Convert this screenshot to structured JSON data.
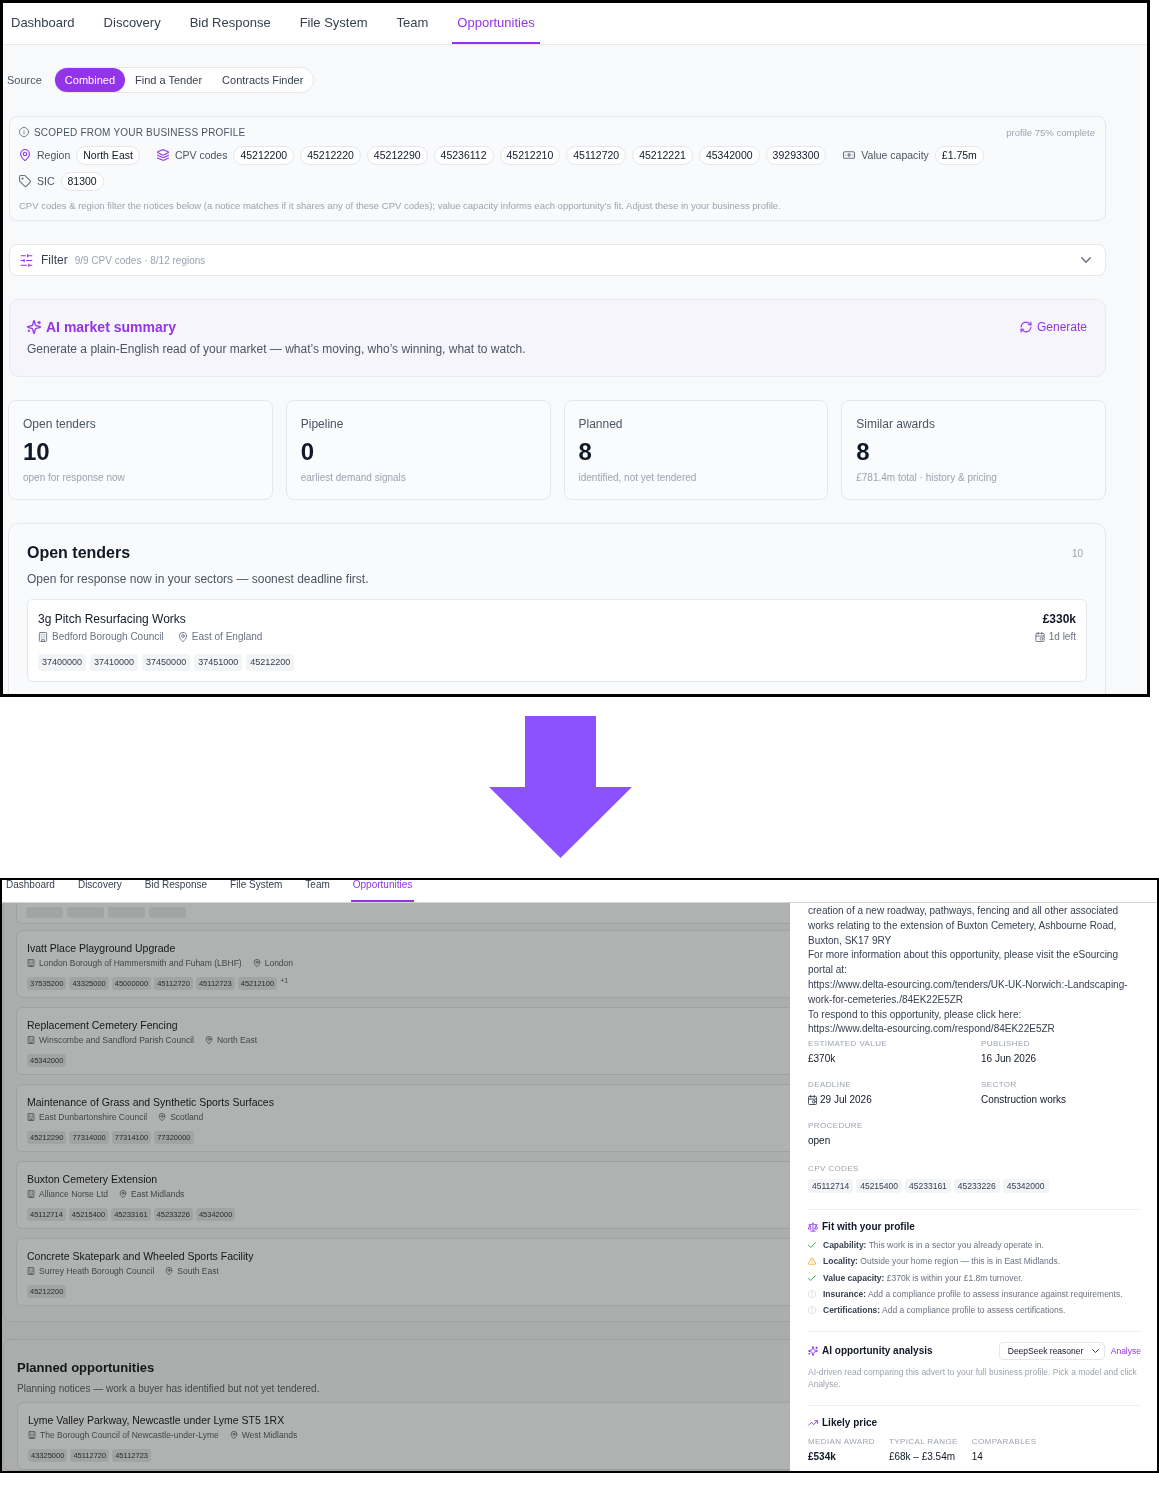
{
  "top_screen": {
    "nav": [
      {
        "label": "Dashboard",
        "selected": false
      },
      {
        "label": "Discovery",
        "selected": false
      },
      {
        "label": "Bid Response",
        "selected": false
      },
      {
        "label": "File System",
        "selected": false
      },
      {
        "label": "Team",
        "selected": false
      },
      {
        "label": "Opportunities",
        "selected": true
      }
    ],
    "source": {
      "label": "Source",
      "options": [
        {
          "label": "Combined",
          "selected": true
        },
        {
          "label": "Find a Tender",
          "selected": false
        },
        {
          "label": "Contracts Finder",
          "selected": false
        }
      ]
    },
    "profile": {
      "heading": "SCOPED FROM YOUR BUSINESS PROFILE",
      "completion": "profile 75% complete",
      "groups": [
        {
          "kind": "region",
          "label": "Region",
          "chips": [
            "North East"
          ]
        },
        {
          "kind": "cpv",
          "label": "CPV codes",
          "chips": [
            "45212200",
            "45212220",
            "45212290",
            "45236112",
            "45212210",
            "45112720",
            "45212221",
            "45342000",
            "39293300"
          ]
        },
        {
          "kind": "value",
          "label": "Value capacity",
          "chips": [
            "£1.75m"
          ]
        },
        {
          "kind": "sic",
          "label": "SIC",
          "chips": [
            "81300"
          ]
        }
      ],
      "note": "CPV codes & region filter the notices below (a notice matches if it shares any of these CPV codes); value capacity informs each opportunity’s fit. Adjust these in your business profile."
    },
    "filter": {
      "label": "Filter",
      "summary": "9/9 CPV codes · 8/12 regions",
      "expanded": false
    },
    "ai_summary": {
      "title": "AI market summary",
      "text": "Generate a plain-English read of your market — what’s moving, who’s winning, what to watch.",
      "action": "Generate"
    },
    "stats": [
      {
        "label": "Open tenders",
        "value": "10",
        "caption": "open for response now"
      },
      {
        "label": "Pipeline",
        "value": "0",
        "caption": "earliest demand signals"
      },
      {
        "label": "Planned",
        "value": "8",
        "caption": "identified, not yet tendered"
      },
      {
        "label": "Similar awards",
        "value": "8",
        "caption": "£781.4m total · history & pricing"
      }
    ],
    "open_tenders": {
      "title": "Open tenders",
      "count": "10",
      "subtitle": "Open for response now in your sectors — soonest deadline first.",
      "items": [
        {
          "title": "3g Pitch Resurfacing Works",
          "buyer": "Bedford Borough Council",
          "region": "East of England",
          "codes": [
            "37400000",
            "37410000",
            "37450000",
            "37451000",
            "45212200"
          ],
          "value": "£330k",
          "deadline": "1d left"
        }
      ]
    }
  },
  "bottom_screen": {
    "nav": [
      {
        "label": "Dashboard",
        "selected": false
      },
      {
        "label": "Discovery",
        "selected": false
      },
      {
        "label": "Bid Response",
        "selected": false
      },
      {
        "label": "File System",
        "selected": false
      },
      {
        "label": "Team",
        "selected": false
      },
      {
        "label": "Opportunities",
        "selected": true
      }
    ],
    "backdrop": true,
    "open_tenders": {
      "items": [
        {
          "title": "Ivatt Place Playground Upgrade",
          "buyer": "London Borough of Hammersmith and Fuham (LBHF)",
          "region": "London",
          "codes": [
            "37535200",
            "43325000",
            "45000000",
            "45112720",
            "45112723",
            "45212100"
          ],
          "more": "+1"
        },
        {
          "title": "Replacement Cemetery Fencing",
          "buyer": "Winscombe and Sandford Parish Council",
          "region": "North East",
          "codes": [
            "45342000"
          ]
        },
        {
          "title": "Maintenance of Grass and Synthetic Sports Surfaces",
          "buyer": "East Dunbartonshire Council",
          "region": "Scotland",
          "codes": [
            "45212290",
            "77314000",
            "77314100",
            "77320000"
          ]
        },
        {
          "title": "Buxton Cemetery Extension",
          "buyer": "Alliance Norse Ltd",
          "region": "East Midlands",
          "codes": [
            "45112714",
            "45215400",
            "45233161",
            "45233226",
            "45342000"
          ]
        },
        {
          "title": "Concrete Skatepark and Wheeled Sports Facility",
          "buyer": "Surrey Heath Borough Council",
          "region": "South East",
          "codes": [
            "45212200"
          ]
        }
      ]
    },
    "planned": {
      "title": "Planned opportunities",
      "subtitle": "Planning notices — work a buyer has identified but not yet tendered.",
      "items": [
        {
          "title": "Lyme Valley Parkway, Newcastle under Lyme ST5 1RX",
          "buyer": "The Borough Council of Newcastle-under-Lyme",
          "region": "West Midlands",
          "codes": [
            "43325000",
            "45112720",
            "45112723"
          ]
        }
      ]
    },
    "detail": {
      "description": [
        "creation of a new roadway, pathways, fencing and all other associated works relating to the extension of Buxton Cemetery, Ashbourne Road, Buxton, SK17 9RY",
        "For more information about this opportunity, please visit the eSourcing portal at:",
        "https://www.delta-esourcing.com/tenders/UK-UK-Norwich:-Landscaping-work-for-cemeteries./84EK22E5ZR",
        "To respond to this opportunity, please click here:",
        "https://www.delta-esourcing.com/respond/84EK22E5ZR"
      ],
      "fields": [
        {
          "kind": "text",
          "label": "ESTIMATED VALUE",
          "value": "£370k"
        },
        {
          "kind": "text",
          "label": "PUBLISHED",
          "value": "16 Jun 2026"
        },
        {
          "kind": "date",
          "label": "DEADLINE",
          "value": "29 Jul 2026"
        },
        {
          "kind": "text",
          "label": "SECTOR",
          "value": "Construction works"
        },
        {
          "kind": "text",
          "label": "PROCEDURE",
          "value": "open"
        }
      ],
      "cpv_label": "CPV CODES",
      "cpv_codes": [
        "45112714",
        "45215400",
        "45233161",
        "45233226",
        "45342000"
      ],
      "fit": {
        "title": "Fit with your profile",
        "checks": [
          {
            "kind": "pass",
            "text": "**Capability:** This work is in a sector you already operate in."
          },
          {
            "kind": "warn",
            "text": "**Locality:** Outside your home region — this is in East Midlands."
          },
          {
            "kind": "pass",
            "text": "**Value capacity:** £370k is within your £1.8m turnover."
          },
          {
            "kind": "unknown",
            "text": "**Insurance:** Add a compliance profile to assess insurance against requirements."
          },
          {
            "kind": "unknown",
            "text": "**Certifications:** Add a compliance profile to assess certifications."
          }
        ]
      },
      "ai_analysis": {
        "title": "AI opportunity analysis",
        "model": "DeepSeek reasoner",
        "action": "Analyse",
        "note": "AI-driven read comparing this advert to your full business profile. Pick a model and click Analyse."
      },
      "likely_price": {
        "title": "Likely price",
        "stats": [
          {
            "label": "MEDIAN AWARD",
            "value": "£534k"
          },
          {
            "label": "TYPICAL RANGE",
            "value": "£68k – £3.54m"
          },
          {
            "label": "COMPARABLES",
            "value": "14"
          }
        ]
      }
    }
  }
}
